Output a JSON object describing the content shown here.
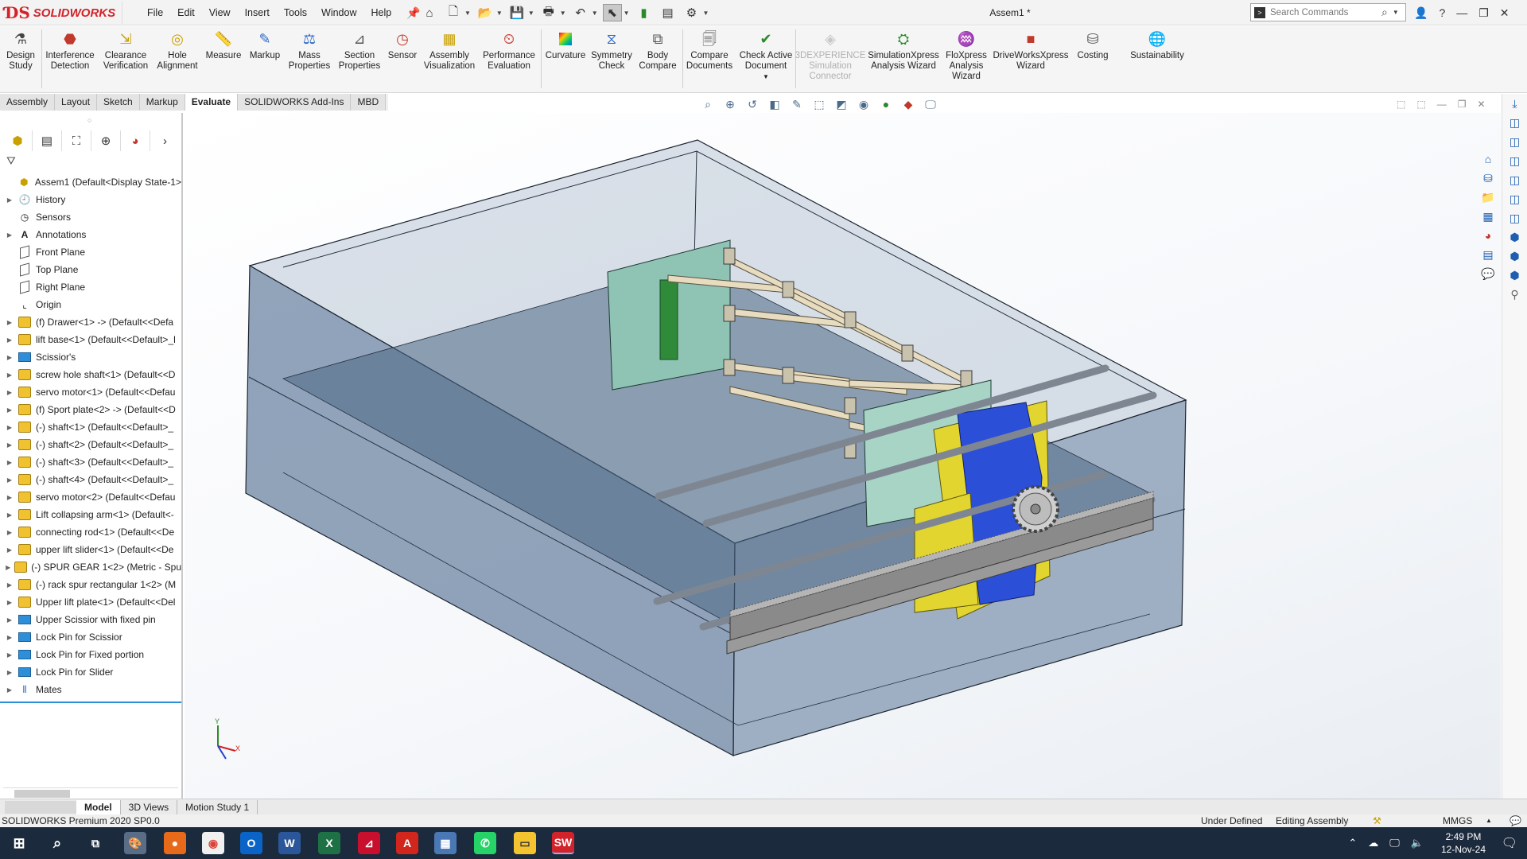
{
  "app": {
    "brand": "SOLIDWORKS",
    "document_title": "Assem1 *"
  },
  "menu": [
    "File",
    "Edit",
    "View",
    "Insert",
    "Tools",
    "Window",
    "Help"
  ],
  "search": {
    "placeholder": "Search Commands"
  },
  "commands": [
    {
      "label": "Design Study",
      "icon": "design-study-icon"
    },
    {
      "label": "Interference Detection",
      "icon": "interference-icon"
    },
    {
      "label": "Clearance Verification",
      "icon": "clearance-icon"
    },
    {
      "label": "Hole Alignment",
      "icon": "hole-alignment-icon"
    },
    {
      "label": "Measure",
      "icon": "measure-icon"
    },
    {
      "label": "Markup",
      "icon": "markup-icon"
    },
    {
      "label": "Mass Properties",
      "icon": "mass-properties-icon"
    },
    {
      "label": "Section Properties",
      "icon": "section-properties-icon"
    },
    {
      "label": "Sensor",
      "icon": "sensor-icon"
    },
    {
      "label": "Assembly Visualization",
      "icon": "assembly-visualization-icon"
    },
    {
      "label": "Performance Evaluation",
      "icon": "performance-icon"
    },
    {
      "label": "Curvature",
      "icon": "curvature-icon"
    },
    {
      "label": "Symmetry Check",
      "icon": "symmetry-icon"
    },
    {
      "label": "Body Compare",
      "icon": "body-compare-icon"
    },
    {
      "label": "Compare Documents",
      "icon": "compare-documents-icon"
    },
    {
      "label": "Check Active Document",
      "icon": "check-document-icon"
    },
    {
      "label": "3DEXPERIENCE Simulation Connector",
      "icon": "3dx-connector-icon",
      "disabled": true
    },
    {
      "label": "SimulationXpress Analysis Wizard",
      "icon": "simulationxpress-icon"
    },
    {
      "label": "FloXpress Analysis Wizard",
      "icon": "floxpress-icon"
    },
    {
      "label": "DriveWorksXpress Wizard",
      "icon": "driveworks-icon"
    },
    {
      "label": "Costing",
      "icon": "costing-icon"
    },
    {
      "label": "Sustainability",
      "icon": "sustainability-icon"
    }
  ],
  "tabs": [
    "Assembly",
    "Layout",
    "Sketch",
    "Markup",
    "Evaluate",
    "SOLIDWORKS Add-Ins",
    "MBD"
  ],
  "active_tab": "Evaluate",
  "tree": [
    {
      "label": "Assem1  (Default<Display State-1>",
      "type": "assembly",
      "expand": false
    },
    {
      "label": "History",
      "type": "history",
      "expand": true
    },
    {
      "label": "Sensors",
      "type": "sensor",
      "expand": false
    },
    {
      "label": "Annotations",
      "type": "annotation",
      "expand": true
    },
    {
      "label": "Front Plane",
      "type": "plane",
      "expand": false
    },
    {
      "label": "Top Plane",
      "type": "plane",
      "expand": false
    },
    {
      "label": "Right Plane",
      "type": "plane",
      "expand": false
    },
    {
      "label": "Origin",
      "type": "origin",
      "expand": false
    },
    {
      "label": "(f) Drawer<1> -> (Default<<Defa",
      "type": "part",
      "expand": true
    },
    {
      "label": "lift base<1> (Default<<Default>_l",
      "type": "part",
      "expand": true
    },
    {
      "label": "Scissior's",
      "type": "folder",
      "expand": true
    },
    {
      "label": "screw hole shaft<1> (Default<<D",
      "type": "part",
      "expand": true
    },
    {
      "label": "servo motor<1> (Default<<Defau",
      "type": "part",
      "expand": true
    },
    {
      "label": "(f) Sport plate<2> -> (Default<<D",
      "type": "part",
      "expand": true
    },
    {
      "label": "(-) shaft<1> (Default<<Default>_",
      "type": "part",
      "expand": true
    },
    {
      "label": "(-) shaft<2> (Default<<Default>_",
      "type": "part",
      "expand": true
    },
    {
      "label": "(-) shaft<3> (Default<<Default>_",
      "type": "part",
      "expand": true
    },
    {
      "label": "(-) shaft<4> (Default<<Default>_",
      "type": "part",
      "expand": true
    },
    {
      "label": "servo motor<2> (Default<<Defau",
      "type": "part",
      "expand": true
    },
    {
      "label": "Lift collapsing arm<1> (Default<-",
      "type": "part",
      "expand": true
    },
    {
      "label": "connecting rod<1> (Default<<De",
      "type": "part",
      "expand": true
    },
    {
      "label": "upper lift slider<1> (Default<<De",
      "type": "part",
      "expand": true
    },
    {
      "label": "(-) SPUR GEAR 1<2> (Metric - Spu",
      "type": "part",
      "expand": true
    },
    {
      "label": "(-) rack spur rectangular 1<2> (M",
      "type": "part",
      "expand": true
    },
    {
      "label": "Upper lift plate<1> (Default<<Del",
      "type": "part",
      "expand": true
    },
    {
      "label": "Upper Scissior with fixed pin",
      "type": "folder",
      "expand": true
    },
    {
      "label": "Lock Pin for Scissior",
      "type": "folder",
      "expand": true
    },
    {
      "label": "Lock Pin for Fixed portion",
      "type": "folder",
      "expand": true
    },
    {
      "label": "Lock Pin for Slider",
      "type": "folder",
      "expand": true
    },
    {
      "label": "Mates",
      "type": "mates",
      "expand": true
    }
  ],
  "bottom_tabs": [
    "Model",
    "3D Views",
    "Motion Study 1"
  ],
  "active_bottom_tab": "Model",
  "status": {
    "product": "SOLIDWORKS Premium 2020 SP0.0",
    "defined": "Under Defined",
    "mode": "Editing Assembly",
    "units": "MMGS"
  },
  "taskbar": {
    "time": "2:49 PM",
    "date": "12-Nov-24"
  },
  "colors": {
    "brand": "#d2232a",
    "accent_blue": "#1e5fb0",
    "box_fill": "#6f87a2",
    "rack": "#8a8a8a",
    "scissor": "#e7dcc0",
    "plate_green": "#8fc3b4",
    "motor_blue": "#2c4fd8",
    "slider_yellow": "#e2d530"
  }
}
